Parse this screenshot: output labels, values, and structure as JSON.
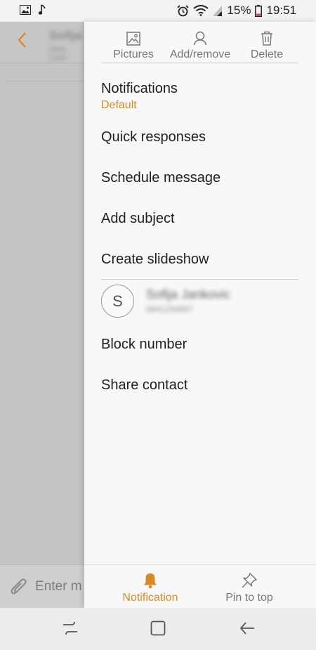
{
  "status_bar": {
    "battery_percent": "15%",
    "time": "19:51",
    "icons": [
      "image-icon",
      "music-note-icon",
      "alarm-icon",
      "wifi-icon",
      "signal-icon",
      "battery-icon"
    ]
  },
  "background": {
    "contact_name": "Sofija",
    "contact_sub": "0641 2345",
    "input_placeholder": "Enter m"
  },
  "drawer": {
    "toolbar": [
      {
        "label": "Pictures",
        "icon": "image-icon"
      },
      {
        "label": "Add/remove",
        "icon": "person-icon"
      },
      {
        "label": "Delete",
        "icon": "trash-icon"
      }
    ],
    "notifications": {
      "label": "Notifications",
      "value": "Default"
    },
    "menu_items": [
      "Quick responses",
      "Schedule message",
      "Add subject",
      "Create slideshow"
    ],
    "contact": {
      "initial": "S",
      "name": "Sofija Jankovic",
      "number": "0641234567"
    },
    "contact_actions": [
      "Block number",
      "Share contact"
    ],
    "bottom_actions": [
      {
        "label": "Notification",
        "icon": "bell-icon",
        "active": true
      },
      {
        "label": "Pin to top",
        "icon": "pin-icon",
        "active": false
      }
    ]
  },
  "colors": {
    "accent": "#d78a23",
    "text": "#1f1f1f",
    "muted": "#777777"
  },
  "nav_bar": {
    "buttons": [
      "recents-button",
      "home-button",
      "back-button"
    ]
  }
}
